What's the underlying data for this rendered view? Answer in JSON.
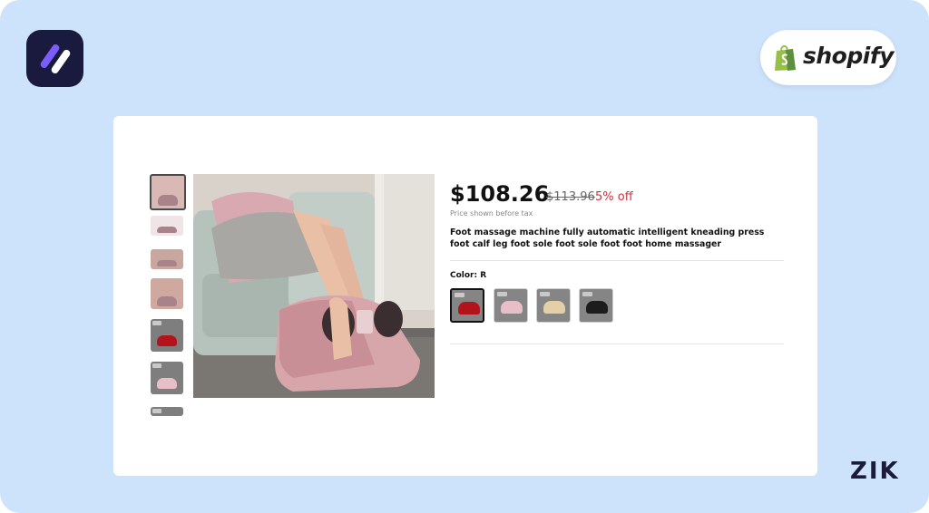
{
  "brand": {
    "shopify_label": "shopify",
    "corner_mark": "ZIK"
  },
  "product": {
    "price_current": "$108.26",
    "price_original": "$113.96",
    "discount": "5% off",
    "price_note": "Price shown before tax",
    "title": "Foot massage machine fully automatic intelligent kneading press foot calf leg foot sole foot sole foot foot home massager",
    "color_label": "Color: R",
    "selected_color_index": 0
  },
  "swatches": [
    {
      "name": "red-swatch",
      "color": "#b3141c"
    },
    {
      "name": "pink-swatch",
      "color": "#e8bfc8"
    },
    {
      "name": "champagne-swatch",
      "color": "#e3cfa8"
    },
    {
      "name": "black-swatch",
      "color": "#1c1c1c"
    }
  ],
  "thumbnails": [
    {
      "kind": "photo",
      "color": "#d8b9b6"
    },
    {
      "kind": "photo",
      "color": "#f1e4e6"
    },
    {
      "kind": "photo",
      "color": "#c8a79e"
    },
    {
      "kind": "photo",
      "color": "#cfa8a0"
    },
    {
      "kind": "product",
      "color": "#b3141c"
    },
    {
      "kind": "product",
      "color": "#e8bfc8"
    },
    {
      "kind": "product",
      "color": "#555555"
    }
  ],
  "colors": {
    "background": "#cde2fb",
    "discount": "#d0313b",
    "shopify_green": "#95bf47"
  }
}
